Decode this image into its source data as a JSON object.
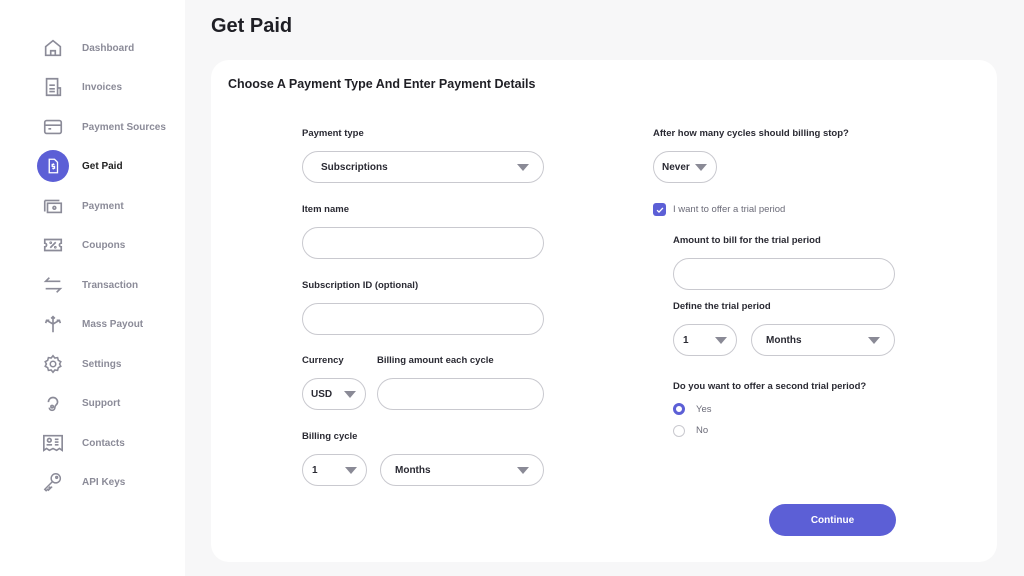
{
  "sidebar": {
    "items": [
      {
        "label": "Dashboard",
        "icon": "home-icon"
      },
      {
        "label": "Invoices",
        "icon": "invoice-icon"
      },
      {
        "label": "Payment Sources",
        "icon": "credit-card-icon"
      },
      {
        "label": "Get Paid",
        "icon": "dollar-document-icon",
        "active": true
      },
      {
        "label": "Payment",
        "icon": "cash-icon"
      },
      {
        "label": "Coupons",
        "icon": "coupon-icon"
      },
      {
        "label": "Transaction",
        "icon": "transfer-arrows-icon"
      },
      {
        "label": "Mass Payout",
        "icon": "split-arrows-icon"
      },
      {
        "label": "Settings",
        "icon": "gear-icon"
      },
      {
        "label": "Support",
        "icon": "support-icon"
      },
      {
        "label": "Contacts",
        "icon": "contact-card-icon"
      },
      {
        "label": "API  Keys",
        "icon": "key-icon"
      }
    ]
  },
  "page": {
    "title": "Get Paid",
    "card_title": "Choose A Payment Type And Enter Payment Details"
  },
  "form": {
    "payment_type": {
      "label": "Payment type",
      "value": "Subscriptions"
    },
    "item_name": {
      "label": "Item name",
      "value": ""
    },
    "subscription_id": {
      "label": "Subscription ID (optional)",
      "value": ""
    },
    "currency": {
      "label": "Currency",
      "value": "USD"
    },
    "billing_amount": {
      "label": "Billing amount each cycle",
      "value": ""
    },
    "billing_cycle": {
      "label": "Billing cycle",
      "count": "1",
      "unit": "Months"
    },
    "billing_stop": {
      "label": "After how many cycles should billing stop?",
      "value": "Never"
    },
    "trial": {
      "checkbox_label": "I want to offer a trial period",
      "checked": true
    },
    "trial_amount": {
      "label": "Amount to bill for the trial period",
      "value": ""
    },
    "trial_period": {
      "label": "Define the trial period",
      "count": "1",
      "unit": "Months"
    },
    "second_trial": {
      "label": "Do you want to offer a second trial period?",
      "options": [
        "Yes",
        "No"
      ],
      "selected": "Yes"
    },
    "continue_label": "Continue"
  },
  "colors": {
    "accent": "#5c5fd6",
    "background": "#f7f7f8",
    "card": "#ffffff"
  }
}
